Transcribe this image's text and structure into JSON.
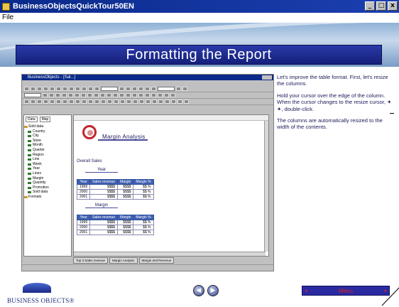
{
  "window": {
    "title": "BusinessObjectsQuickTour50EN",
    "menu": "File",
    "controls": [
      "_",
      "□",
      "x"
    ]
  },
  "banner": {
    "title": "Formatting the Report"
  },
  "app": {
    "title": "BusinessObjects - [Sal...]",
    "tree_tabs": [
      "Data",
      "Map"
    ],
    "tree": {
      "root": "Sold data",
      "items": [
        "Country",
        "City",
        "Store",
        "Month",
        "Quarter",
        "Region",
        "Line",
        "Week",
        "Year",
        "Lines",
        "Margin",
        "Quantity",
        "Promotion",
        "Sold data"
      ],
      "footer": "Formats"
    },
    "report": {
      "logo_alt": "Sales logo",
      "title": "Margin Analysis",
      "section": "Overall Sales",
      "groups": [
        {
          "label": "Year",
          "columns": [
            "Year",
            "Sales revenue",
            "Margin",
            "Margin %"
          ],
          "rows": [
            [
              "1999",
              "$$$$",
              "$$$$",
              "$$ %"
            ],
            [
              "2000",
              "$$$$",
              "$$$$",
              "$$ %"
            ],
            [
              "2001",
              "$$$$",
              "$$$$",
              "$$ %"
            ]
          ]
        },
        {
          "label": "Margin",
          "columns": [
            "Year",
            "Sales revenue",
            "Margin",
            "Margin %"
          ],
          "rows": [
            [
              "1999",
              "$$$$",
              "$$$$",
              "$$ %"
            ],
            [
              "2000",
              "$$$$",
              "$$$$",
              "$$ %"
            ],
            [
              "2001",
              "$$$$",
              "$$$$",
              "$$ %"
            ]
          ]
        }
      ]
    },
    "tabs": [
      "Top 3 Sales revenue",
      "Margin Analysis",
      "Margin and Revenue"
    ]
  },
  "instructions": [
    "Let's improve the table format. First, let's resize the columns.",
    "Hold your cursor over the edge of the column. When the cursor changes to the resize cursor, ✦ ✦, double-click.",
    "The columns are automatically resized to the width of the contents."
  ],
  "footer": {
    "logo_text": "BUSINESS OBJECTS®",
    "prev_icon": "◀",
    "next_icon": "▶",
    "menu_label": "Menu",
    "menu_left": "◂",
    "menu_right": "▸"
  }
}
